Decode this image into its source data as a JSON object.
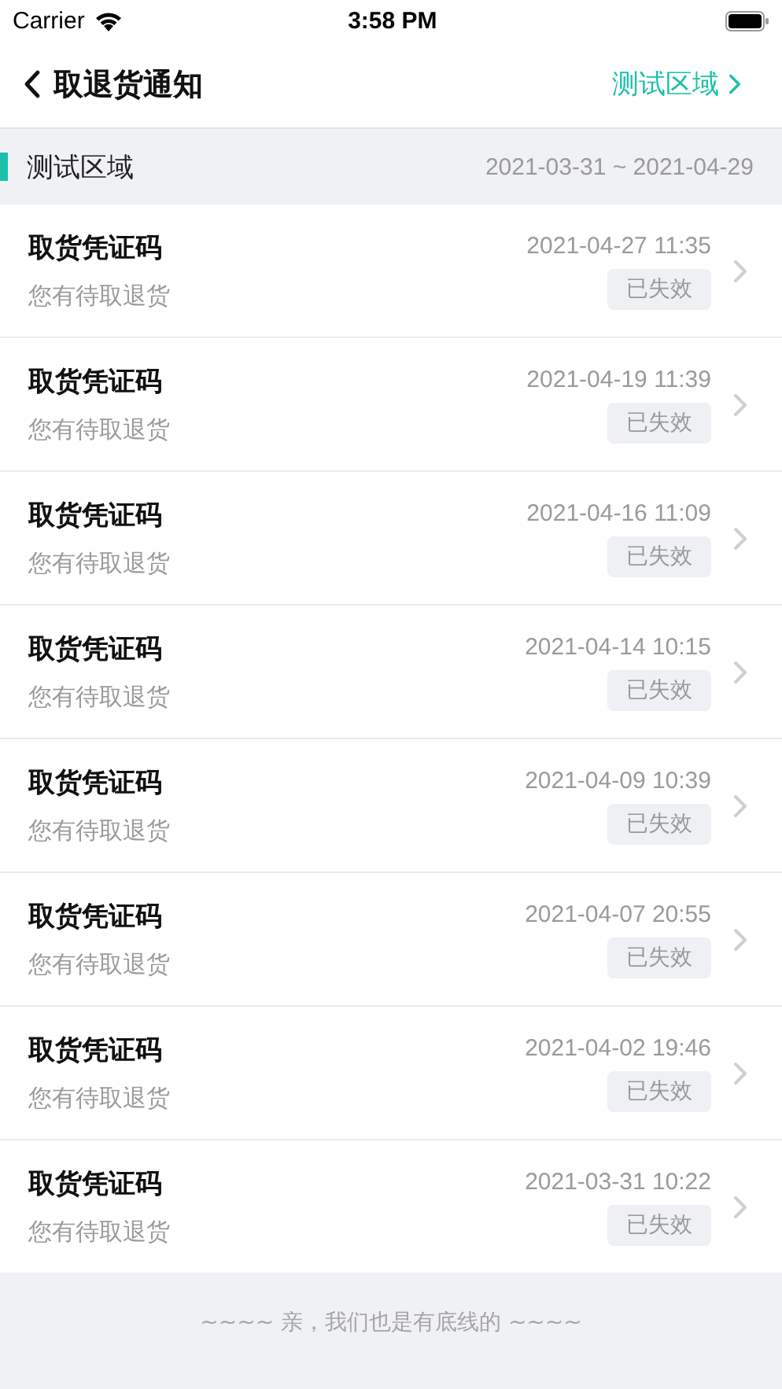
{
  "status_bar": {
    "carrier": "Carrier",
    "time": "3:58 PM"
  },
  "nav": {
    "title": "取退货通知",
    "right_link": "测试区域"
  },
  "section": {
    "title": "测试区域",
    "range": "2021-03-31 ~ 2021-04-29"
  },
  "items": [
    {
      "title": "取货凭证码",
      "subtitle": "您有待取退货",
      "time": "2021-04-27 11:35",
      "status": "已失效"
    },
    {
      "title": "取货凭证码",
      "subtitle": "您有待取退货",
      "time": "2021-04-19 11:39",
      "status": "已失效"
    },
    {
      "title": "取货凭证码",
      "subtitle": "您有待取退货",
      "time": "2021-04-16 11:09",
      "status": "已失效"
    },
    {
      "title": "取货凭证码",
      "subtitle": "您有待取退货",
      "time": "2021-04-14 10:15",
      "status": "已失效"
    },
    {
      "title": "取货凭证码",
      "subtitle": "您有待取退货",
      "time": "2021-04-09 10:39",
      "status": "已失效"
    },
    {
      "title": "取货凭证码",
      "subtitle": "您有待取退货",
      "time": "2021-04-07 20:55",
      "status": "已失效"
    },
    {
      "title": "取货凭证码",
      "subtitle": "您有待取退货",
      "time": "2021-04-02 19:46",
      "status": "已失效"
    },
    {
      "title": "取货凭证码",
      "subtitle": "您有待取退货",
      "time": "2021-03-31 10:22",
      "status": "已失效"
    }
  ],
  "footer": "~~~~ 亲，我们也是有底线的 ~~~~"
}
